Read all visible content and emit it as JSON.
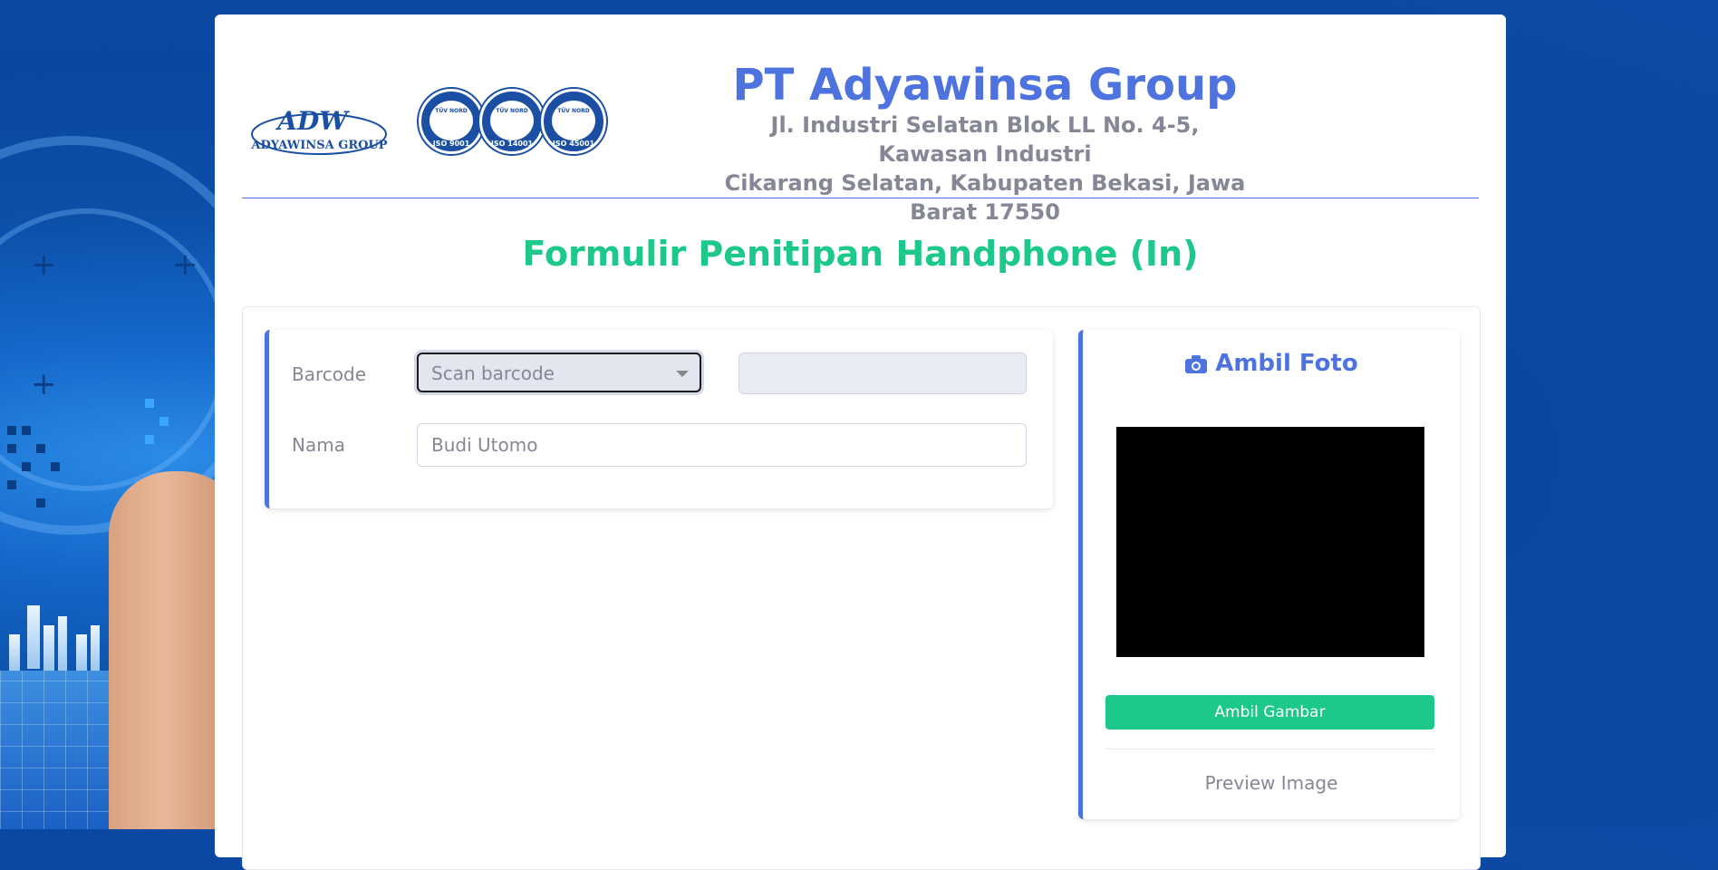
{
  "header": {
    "company_name": "PT Adyawinsa Group",
    "address_line1": "Jl. Industri Selatan Blok LL No. 4-5, Kawasan Industri",
    "address_line2": "Cikarang Selatan, Kabupaten Bekasi, Jawa Barat 17550",
    "logo_text": "ADYAWINSA GROUP",
    "logo_mark": "ADW",
    "certifications": [
      {
        "label": "ISO 9001",
        "issuer": "TÜV NORD"
      },
      {
        "label": "ISO 14001",
        "issuer": "TÜV NORD"
      },
      {
        "label": "ISO 45001",
        "issuer": "TÜV NORD"
      }
    ]
  },
  "form": {
    "title": "Formulir Penitipan Handphone (In)",
    "barcode_label": "Barcode",
    "barcode_placeholder": "Scan barcode",
    "barcode_value": "",
    "name_label": "Nama",
    "name_placeholder": "Budi Utomo"
  },
  "photo": {
    "title": "Ambil Foto",
    "title_icon": "camera-icon",
    "take_button": "Ambil Gambar",
    "preview_label": "Preview Image"
  },
  "colors": {
    "primary": "#4e73df",
    "success": "#1cc88a",
    "muted": "#858796"
  }
}
